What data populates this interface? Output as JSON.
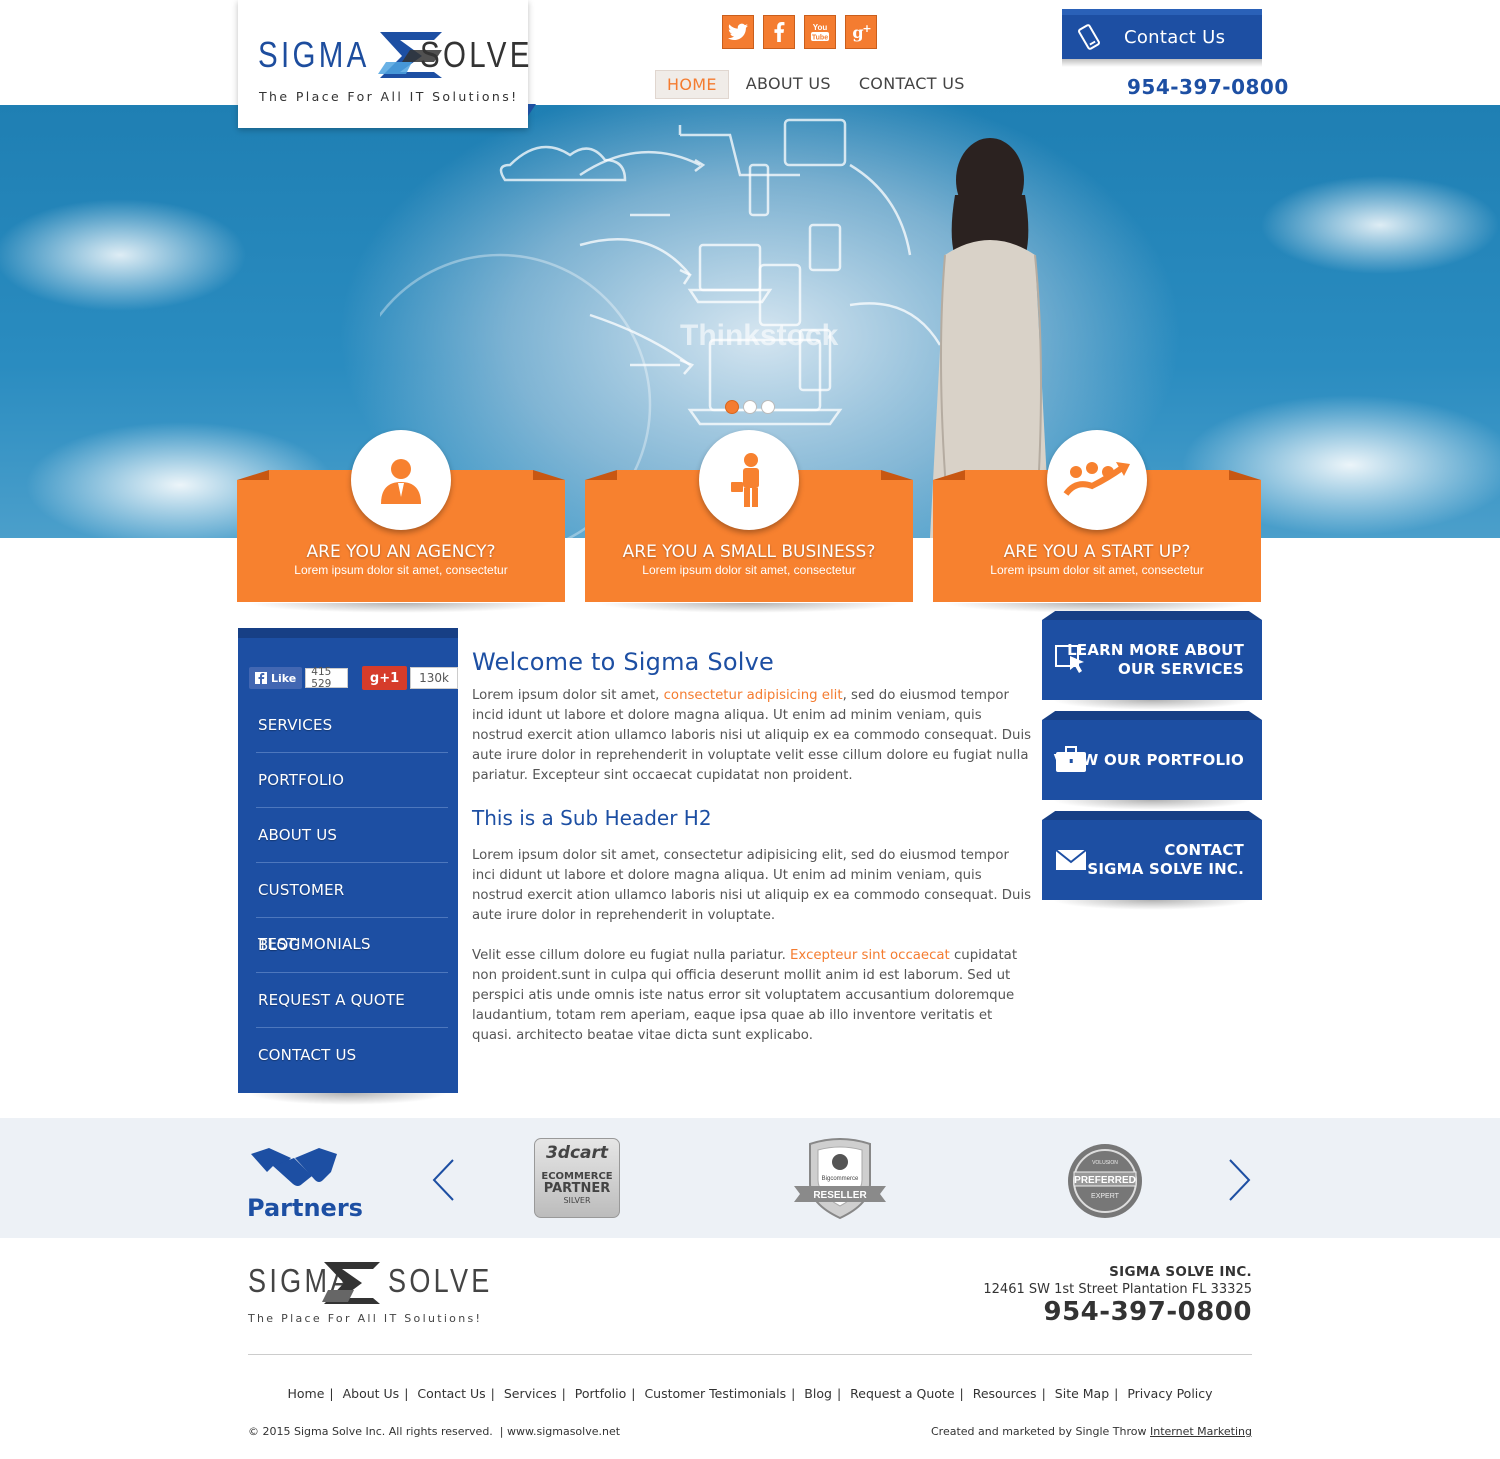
{
  "header": {
    "logo": {
      "left": "SIGMA",
      "right": "SOLVE",
      "tagline": "The Place For All IT Solutions!"
    },
    "social": [
      {
        "name": "twitter",
        "glyph": "t"
      },
      {
        "name": "facebook",
        "glyph": "f"
      },
      {
        "name": "youtube",
        "glyph": "You"
      },
      {
        "name": "google-plus",
        "glyph": "g+"
      }
    ],
    "nav": [
      {
        "label": "HOME",
        "active": true
      },
      {
        "label": "ABOUT US",
        "active": false
      },
      {
        "label": "CONTACT US",
        "active": false
      }
    ],
    "contact_tab": "Contact Us",
    "phone": "954-397-0800"
  },
  "hero": {
    "slides": 3,
    "active_slide": 1
  },
  "features": [
    {
      "title": "ARE YOU AN AGENCY?",
      "subtitle": "Lorem ipsum dolor sit amet, consectetur",
      "icon": "person-icon"
    },
    {
      "title": "ARE YOU A SMALL BUSINESS?",
      "subtitle": "Lorem ipsum dolor sit amet, consectetur",
      "icon": "businessman-icon"
    },
    {
      "title": "ARE YOU A START UP?",
      "subtitle": "Lorem ipsum dolor sit amet, consectetur",
      "icon": "team-growth-icon"
    }
  ],
  "sidebar": {
    "fb_like": "Like",
    "fb_count": "415 529",
    "gplus": "g+1",
    "gplus_count": "130k",
    "items": [
      "SERVICES",
      "PORTFOLIO",
      "ABOUT US",
      "CUSTOMER TESTIMONIALS",
      "BLOG",
      "REQUEST A QUOTE",
      "CONTACT US"
    ]
  },
  "content": {
    "title": "Welcome to Sigma Solve",
    "p1_a": "Lorem ipsum dolor sit amet, ",
    "p1_link": "consectetur adipisicing elit",
    "p1_b": ", sed do eiusmod tempor incid idunt ut labore et dolore magna aliqua. Ut enim ad minim veniam, quis nostrud exercit ation ullamco laboris nisi ut aliquip ex ea commodo consequat. Duis aute irure dolor in reprehenderit in voluptate velit esse cillum dolore eu fugiat nulla pariatur. Excepteur sint occaecat cupidatat non proident.",
    "subtitle": "This is a Sub Header H2",
    "p2": "Lorem ipsum dolor sit amet, consectetur adipisicing elit, sed do eiusmod tempor inci didunt ut labore et dolore magna aliqua. Ut enim ad minim veniam, quis nostrud exercit ation ullamco laboris nisi ut aliquip ex ea commodo consequat. Duis aute irure dolor in reprehenderit in voluptate.",
    "p3_a": "Velit esse cillum dolore eu fugiat nulla pariatur. ",
    "p3_link": "Excepteur sint occaecat",
    "p3_b": " cupidatat non proident.sunt in culpa qui officia deserunt mollit anim id est laborum. Sed ut perspici atis unde omnis iste natus error sit voluptatem accusantium doloremque laudantium, totam rem aperiam, eaque ipsa quae ab illo inventore veritatis et quasi. architecto beatae vitae dicta sunt explicabo."
  },
  "cta": [
    {
      "line1": "LEARN MORE ABOUT",
      "line2": "OUR SERVICES",
      "icon": "click-pointer-icon"
    },
    {
      "line1": "VIEW OUR PORTFOLIO",
      "line2": "",
      "icon": "briefcase-icon"
    },
    {
      "line1": "CONTACT",
      "line2": "SIGMA SOLVE INC.",
      "icon": "envelope-icon"
    }
  ],
  "partners": {
    "title": "Partners",
    "badge_3dcart": {
      "brand": "3dcart",
      "line1": "ECOMMERCE",
      "line2": "PARTNER",
      "line3": "SILVER"
    },
    "badge_bigcommerce": {
      "brand": "Bigcommerce",
      "ribbon": "RESELLER"
    },
    "badge_volusion": {
      "brand": "VOLUSION",
      "main": "PREFERRED",
      "sub": "EXPERT"
    }
  },
  "footer": {
    "company": "SIGMA SOLVE INC.",
    "address": "12461 SW 1st Street Plantation FL 33325",
    "phone": "954-397-0800",
    "links": [
      "Home",
      "About Us",
      "Contact Us",
      "Services",
      "Portfolio",
      "Customer Testimonials",
      "Blog",
      "Request a Quote",
      "Resources",
      "Site Map",
      "Privacy Policy"
    ],
    "copyright": "© 2015 Sigma Solve Inc. All rights reserved.",
    "website": "www.sigmasolve.net",
    "credit": "Created and marketed by Single Throw",
    "credit_link": "Internet Marketing"
  },
  "colors": {
    "brand_blue": "#1d4fa3",
    "accent_orange": "#f47c30",
    "partners_bg": "#edf1f6"
  }
}
